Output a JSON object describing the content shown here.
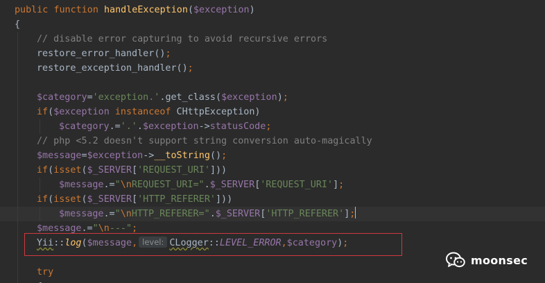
{
  "lines": {
    "l1": {
      "t1": "public",
      "t2": " ",
      "t3": "function",
      "t4": " ",
      "t5": "handleException",
      "t6": "(",
      "t7": "$exception",
      "t8": ")"
    },
    "l2": {
      "t1": "{"
    },
    "l3": {
      "t1": "// disable error capturing to avoid recursive errors"
    },
    "l4": {
      "t1": "restore_error_handler",
      "t2": "()",
      "t3": ";"
    },
    "l5": {
      "t1": "restore_exception_handler",
      "t2": "()",
      "t3": ";"
    },
    "l7": {
      "t1": "$category",
      "t2": "=",
      "t3": "'exception.'",
      "t4": ".",
      "t5": "get_class",
      "t6": "(",
      "t7": "$exception",
      "t8": ")",
      "t9": ";"
    },
    "l8": {
      "t1": "if",
      "t2": "(",
      "t3": "$exception",
      "t4": " ",
      "t5": "instanceof",
      "t6": " CHttpException)"
    },
    "l9": {
      "t1": "$category",
      "t2": ".=",
      "t3": "'.'",
      "t4": ".",
      "t5": "$exception",
      "t6": "->",
      "t7": "statusCode",
      "t8": ";"
    },
    "l10": {
      "t1": "// php <5.2 doesn't support string conversion auto-magically"
    },
    "l11": {
      "t1": "$message",
      "t2": "=",
      "t3": "$exception",
      "t4": "->",
      "t5": "__toString",
      "t6": "()",
      "t7": ";"
    },
    "l12": {
      "t1": "if",
      "t2": "(",
      "t3": "isset",
      "t4": "(",
      "t5": "$_SERVER",
      "t6": "[",
      "t7": "'REQUEST_URI'",
      "t8": "]))"
    },
    "l13": {
      "t1": "$message",
      "t2": ".=",
      "t3": "\"",
      "t4": "\\n",
      "t5": "REQUEST_URI=\"",
      "t6": ".",
      "t7": "$_SERVER",
      "t8": "[",
      "t9": "'REQUEST_URI'",
      "t10": "]",
      "t11": ";"
    },
    "l14": {
      "t1": "if",
      "t2": "(",
      "t3": "isset",
      "t4": "(",
      "t5": "$_SERVER",
      "t6": "[",
      "t7": "'HTTP_REFERER'",
      "t8": "]))"
    },
    "l15": {
      "t1": "$message",
      "t2": ".=",
      "t3": "\"",
      "t4": "\\n",
      "t5": "HTTP_REFERER=\"",
      "t6": ".",
      "t7": "$_SERVER",
      "t8": "[",
      "t9": "'HTTP_REFERER'",
      "t10": "]",
      "t11": ";"
    },
    "l16": {
      "t1": "$message",
      "t2": ".=",
      "t3": "\"",
      "t4": "\\n",
      "t5": "---\"",
      "t6": ";"
    },
    "l17": {
      "t1": "Yii",
      "t2": "::",
      "t3": "log",
      "t4": "(",
      "t5": "$message",
      "t6": ",",
      "hint": "level:",
      "t7": "CLogger",
      "t8": "::",
      "t9": "LEVEL_ERROR",
      "t10": ",",
      "t11": "$category",
      "t12": ")",
      "t13": ";"
    },
    "l19": {
      "t1": "try"
    },
    "l20": {
      "t1": "{"
    }
  },
  "watermark": {
    "text": "moonsec",
    "icon": "wechat-icon"
  },
  "colors": {
    "background": "#2b2b2b",
    "keyword": "#cc7832",
    "function": "#ffc66d",
    "variable": "#9876aa",
    "string": "#6a8759",
    "comment": "#808080",
    "default": "#a9b7c6",
    "highlight_box": "#d0393e"
  }
}
